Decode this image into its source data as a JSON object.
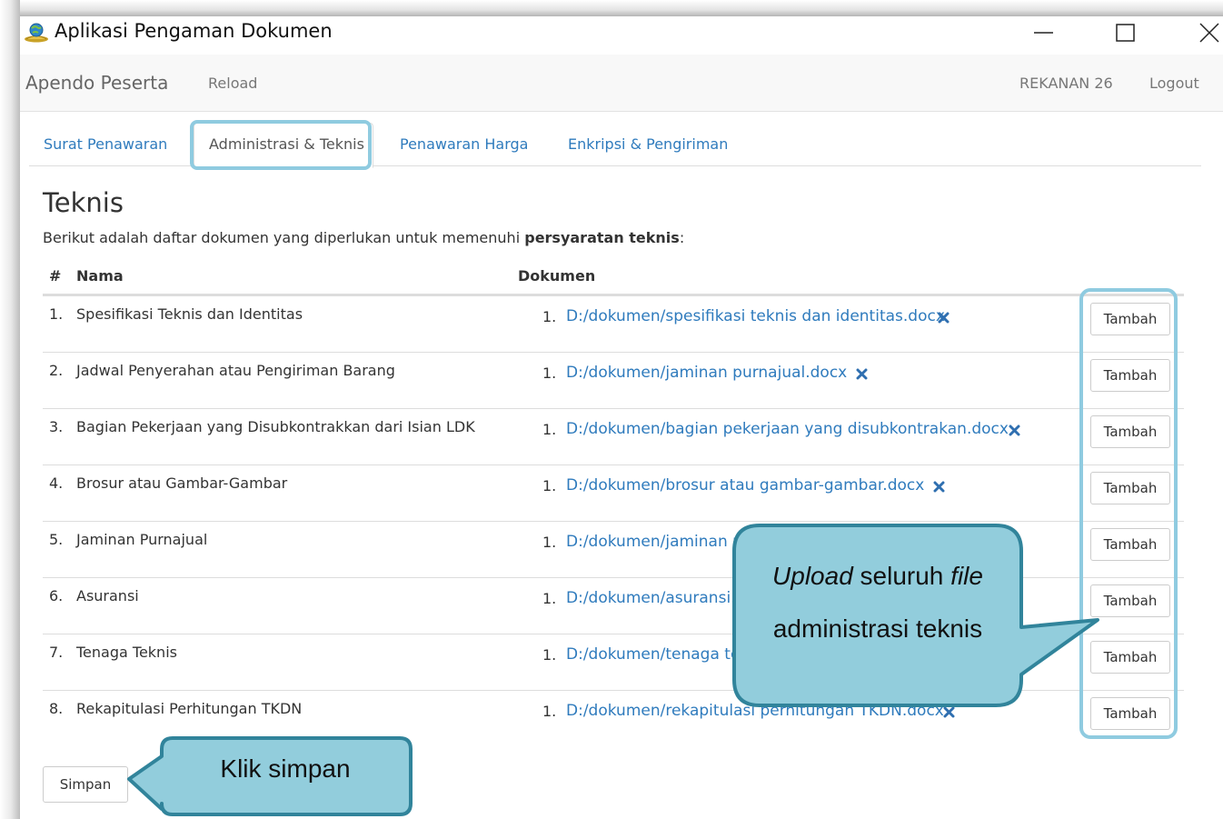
{
  "window": {
    "title": "Aplikasi Pengaman Dokumen"
  },
  "navbar": {
    "brand": "Apendo Peserta",
    "reload": "Reload",
    "user": "REKANAN 26",
    "logout": "Logout"
  },
  "tabs": [
    {
      "label": "Surat Penawaran",
      "active": false
    },
    {
      "label": "Administrasi & Teknis",
      "active": true
    },
    {
      "label": "Penawaran Harga",
      "active": false
    },
    {
      "label": "Enkripsi & Pengiriman",
      "active": false
    }
  ],
  "section": {
    "title": "Teknis",
    "description_prefix": "Berikut adalah daftar dokumen yang diperlukan untuk memenuhi ",
    "description_bold": "persyaratan teknis",
    "description_suffix": ":"
  },
  "table": {
    "headers": {
      "num": "#",
      "name": "Nama",
      "document": "Dokumen"
    },
    "rows": [
      {
        "num": "1.",
        "name": "Spesifikasi Teknis dan Identitas",
        "doc_num": "1.",
        "doc": "D:/dokumen/spesifikasi teknis dan identitas.docx",
        "button": "Tambah"
      },
      {
        "num": "2.",
        "name": "Jadwal Penyerahan atau Pengiriman Barang",
        "doc_num": "1.",
        "doc": "D:/dokumen/jaminan purnajual.docx",
        "button": "Tambah"
      },
      {
        "num": "3.",
        "name": "Bagian Pekerjaan yang Disubkontrakkan dari Isian LDK",
        "doc_num": "1.",
        "doc": "D:/dokumen/bagian pekerjaan yang disubkontrakan.docx",
        "button": "Tambah"
      },
      {
        "num": "4.",
        "name": "Brosur atau Gambar-Gambar",
        "doc_num": "1.",
        "doc": "D:/dokumen/brosur atau gambar-gambar.docx",
        "button": "Tambah"
      },
      {
        "num": "5.",
        "name": "Jaminan Purnajual",
        "doc_num": "1.",
        "doc": "D:/dokumen/jaminan p",
        "button": "Tambah"
      },
      {
        "num": "6.",
        "name": "Asuransi",
        "doc_num": "1.",
        "doc": "D:/dokumen/asuransi.c",
        "button": "Tambah"
      },
      {
        "num": "7.",
        "name": "Tenaga Teknis",
        "doc_num": "1.",
        "doc": "D:/dokumen/tenaga te",
        "button": "Tambah"
      },
      {
        "num": "8.",
        "name": "Rekapitulasi Perhitungan TKDN",
        "doc_num": "1.",
        "doc": "D:/dokumen/rekapitulasi perhitungan TKDN.docx",
        "button": "Tambah"
      }
    ]
  },
  "save_button": "Simpan",
  "callouts": {
    "upload_italic_1": "Upload",
    "upload_middle": " seluruh ",
    "upload_italic_2": "file",
    "upload_line_2": "administrasi teknis",
    "save": "Klik simpan"
  },
  "colors": {
    "link": "#2f7bbd",
    "highlight_border": "#8fcbe0",
    "callout_fill": "#92cddc",
    "callout_border": "#31849b",
    "remove_icon": "#2f6fb0"
  }
}
